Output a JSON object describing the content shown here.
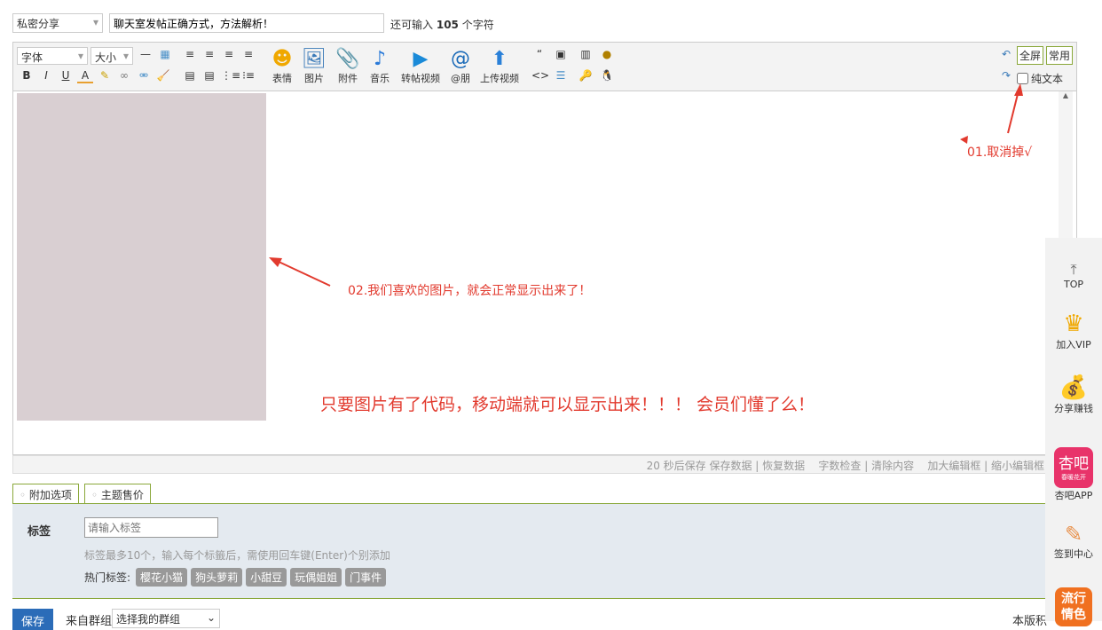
{
  "header": {
    "category": "私密分享",
    "title_value": "聊天室发帖正确方式，方法解析！",
    "remaining_prefix": "还可输入",
    "remaining_count": "105",
    "remaining_suffix": "个字符"
  },
  "toolbar": {
    "font": "字体",
    "size": "大小",
    "big_buttons": [
      "表情",
      "图片",
      "附件",
      "音乐",
      "转帖视频",
      "@朋",
      "上传视频"
    ],
    "fullscreen": "全屏",
    "common": "常用",
    "plain_text": "纯文本"
  },
  "editor": {
    "note1": "01.取消掉√",
    "note2": "02.我们喜欢的图片，就会正常显示出来了！",
    "note3": "只要图片有了代码，移动端就可以显示出来！！！ 会员们懂了么！"
  },
  "status": {
    "text": "20 秒后保存 保存数据 | 恢复数据    字数检查 | 清除内容    加大编辑框 | 缩小编辑框"
  },
  "tabs": [
    "附加选项",
    "主题售价"
  ],
  "options": {
    "tag_label": "标签",
    "tag_placeholder": "请输入标签",
    "tag_hint": "标签最多10个，输入每个标籤后，需使用回车键(Enter)个别添加",
    "hot_label": "热门标签:",
    "hot_tags": [
      "樱花小猫",
      "狗头萝莉",
      "小甜豆",
      "玩偶姐姐",
      "门事件"
    ]
  },
  "footer": {
    "save": "保存",
    "group_label": "来自群组:",
    "group_select": "选择我的群组",
    "right_text": "本版积"
  },
  "sidebar": {
    "items": [
      "TOP",
      "加入VIP",
      "分享赚钱",
      "杏吧APP",
      "签到中心"
    ],
    "app_logo": "杏吧",
    "app_sub": "春暖花开",
    "popular_logo": "流行情色"
  },
  "colors": {
    "annotation": "#e23a2e",
    "accent_green": "#8aa83a",
    "save_blue": "#2b6cb8"
  }
}
